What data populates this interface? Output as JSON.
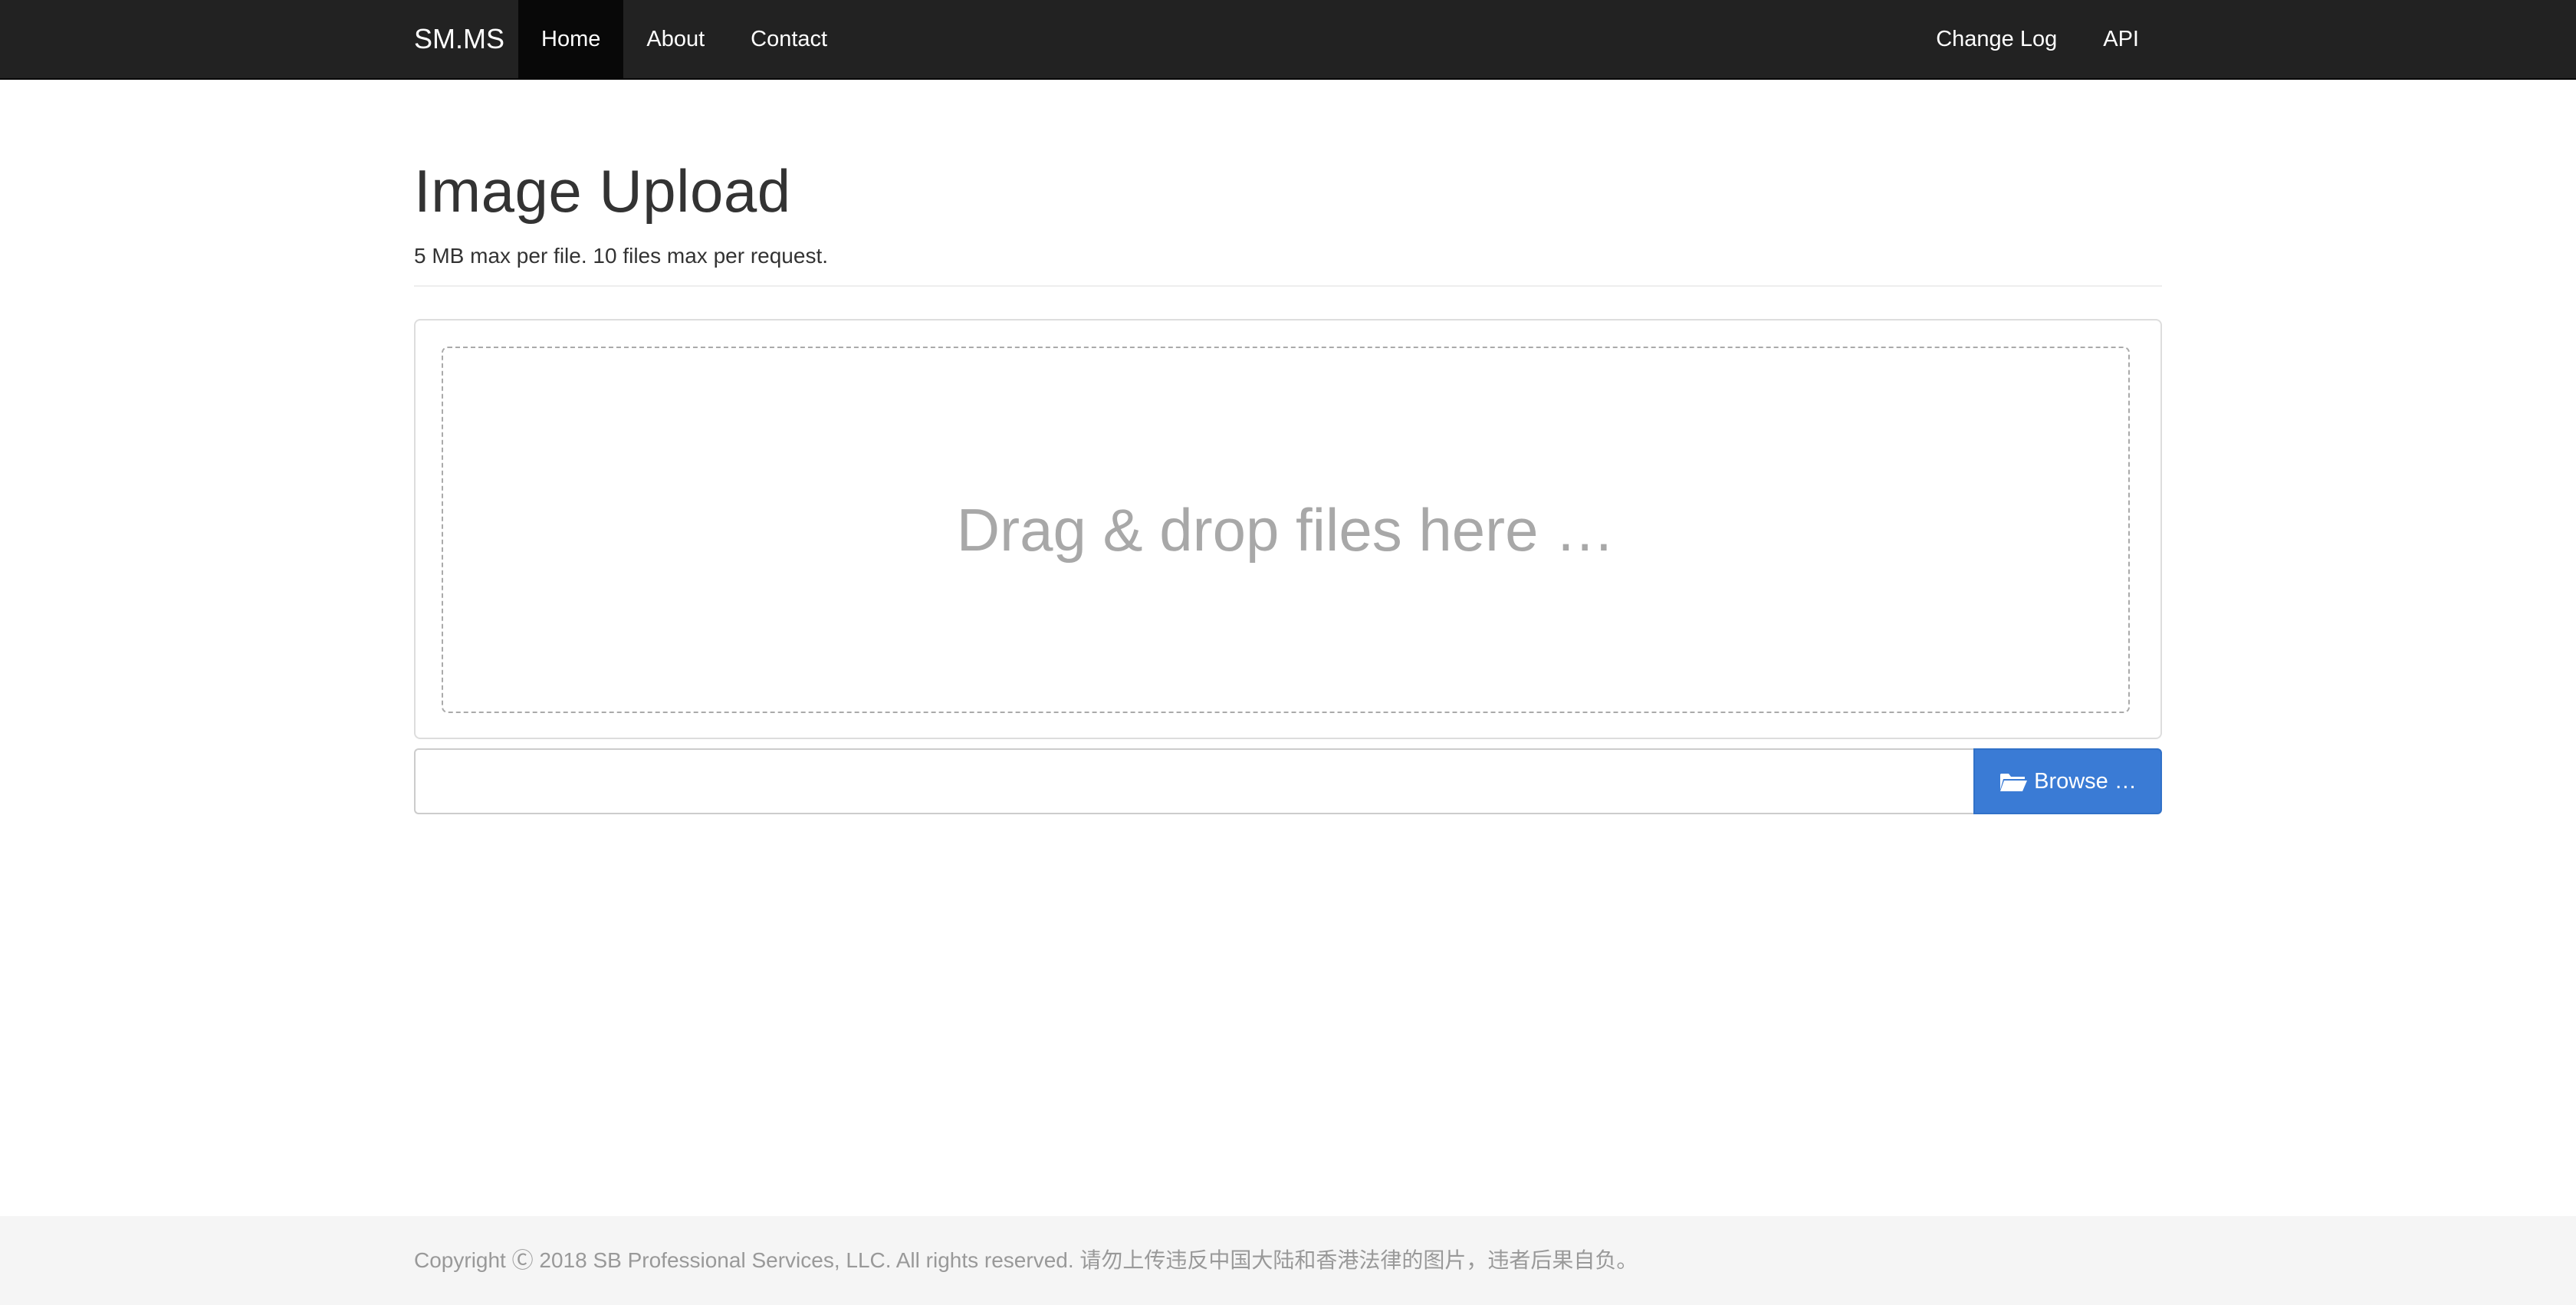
{
  "navbar": {
    "brand": "SM.MS",
    "left_items": [
      {
        "label": "Home",
        "active": true
      },
      {
        "label": "About",
        "active": false
      },
      {
        "label": "Contact",
        "active": false
      }
    ],
    "right_items": [
      {
        "label": "Change Log"
      },
      {
        "label": "API"
      }
    ]
  },
  "header": {
    "title": "Image Upload",
    "subtitle": "5 MB max per file. 10 files max per request."
  },
  "dropzone": {
    "text": "Drag & drop files here …"
  },
  "file_input": {
    "caption_value": "",
    "browse_label": "Browse …",
    "browse_icon": "folder-open-icon"
  },
  "footer": {
    "text": "Copyright Ⓒ 2018 SB Professional Services, LLC. All rights reserved. 请勿上传违反中国大陆和香港法律的图片，违者后果自负。"
  },
  "colors": {
    "navbar_bg": "#222222",
    "active_tab_bg": "#080808",
    "browse_button_bg": "#3a7bd5",
    "drop_text": "#a8a8a8",
    "footer_bg": "#f5f5f5",
    "footer_text": "#999999"
  }
}
